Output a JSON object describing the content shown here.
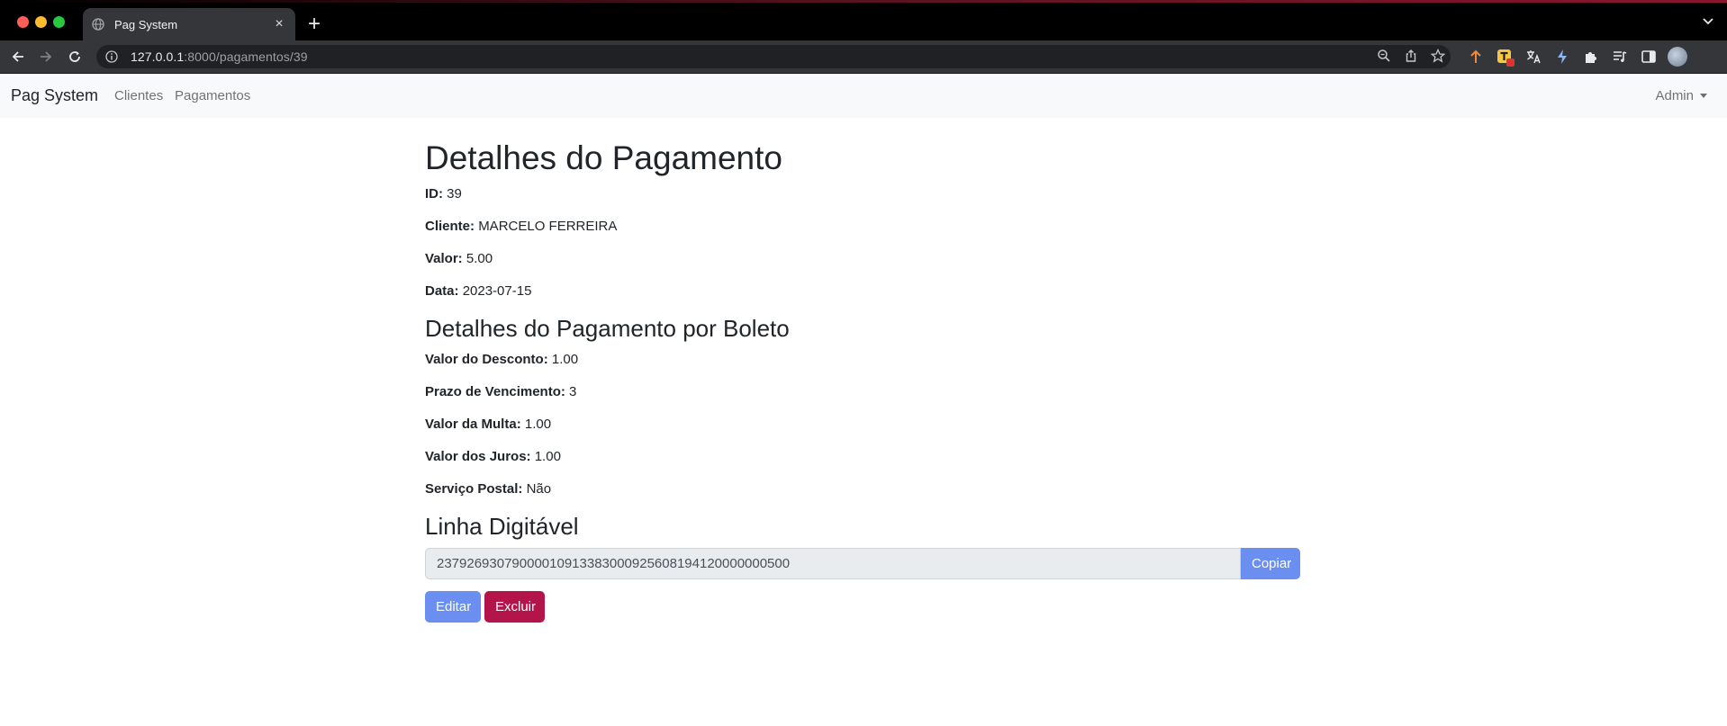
{
  "browser": {
    "tab_title": "Pag System",
    "tab_close": "×",
    "new_tab": "+",
    "url_host": "127.0.0.1",
    "url_rest": ":8000/pagamentos/39"
  },
  "navbar": {
    "brand": "Pag System",
    "links": [
      "Clientes",
      "Pagamentos"
    ],
    "user": "Admin"
  },
  "page": {
    "title": "Detalhes do Pagamento",
    "fields": [
      {
        "label": "ID:",
        "value": "39"
      },
      {
        "label": "Cliente:",
        "value": "MARCELO FERREIRA"
      },
      {
        "label": "Valor:",
        "value": "5.00"
      },
      {
        "label": "Data:",
        "value": "2023-07-15"
      }
    ],
    "boleto_title": "Detalhes do Pagamento por Boleto",
    "boleto_fields": [
      {
        "label": "Valor do Desconto:",
        "value": "1.00"
      },
      {
        "label": "Prazo de Vencimento:",
        "value": "3"
      },
      {
        "label": "Valor da Multa:",
        "value": "1.00"
      },
      {
        "label": "Valor dos Juros:",
        "value": "1.00"
      },
      {
        "label": "Serviço Postal:",
        "value": "Não"
      }
    ],
    "linha_title": "Linha Digitável",
    "linha_value": "23792693079000010913383000925608194120000000500",
    "copy_label": "Copiar",
    "edit_label": "Editar",
    "delete_label": "Excluir"
  },
  "colors": {
    "primary": "#6b8ff0",
    "danger": "#b3154a",
    "navbar_bg": "#f8f9fa"
  }
}
